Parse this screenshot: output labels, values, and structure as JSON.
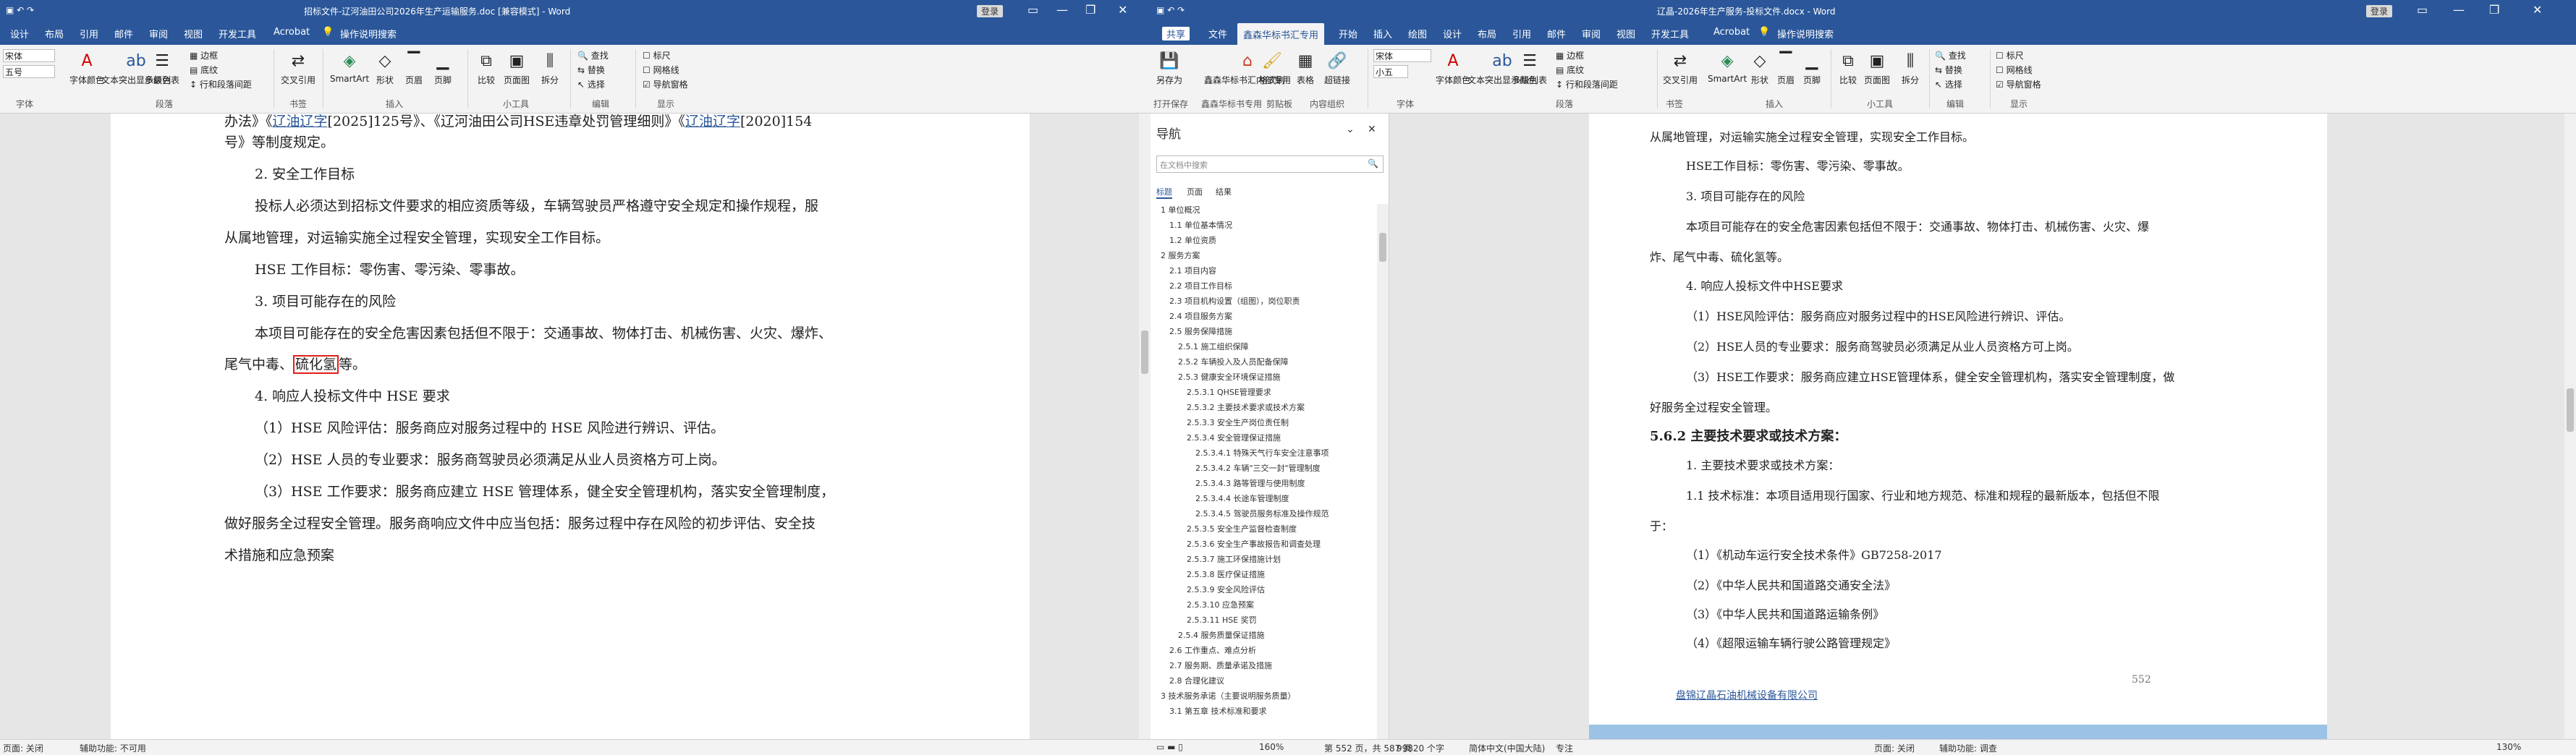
{
  "left_window": {
    "title": "招标文件-辽河油田公司2026年生产运输服务.doc [兼容模式] - Word",
    "signin": "登录",
    "qat": [
      "保存",
      "撤销",
      "重复"
    ],
    "tabs": [
      "设计",
      "布局",
      "引用",
      "邮件",
      "审阅",
      "视图",
      "开发工具",
      "Acrobat"
    ],
    "tell_me": "操作说明搜索",
    "ribbon": {
      "font_name": "宋体",
      "font_size": "五号",
      "font_buttons": [
        "字体颜色",
        "文本突出显示颜色",
        "多级列表"
      ],
      "para_small": [
        "边框",
        "底纹",
        "行和段落间距"
      ],
      "insert_buttons": [
        "交叉引用",
        "SmartArt",
        "形状",
        "页眉",
        "页脚"
      ],
      "tool_buttons": [
        "比较",
        "页面图",
        "拆分"
      ],
      "edit_small": [
        "查找",
        "替换",
        "选择"
      ],
      "show_small": [
        "标尺",
        "网格线",
        "导航窗格"
      ],
      "groups": [
        "字体",
        "段落",
        "书签",
        "插入",
        "小工具",
        "编辑",
        "显示"
      ]
    },
    "doc": {
      "line0_pre": "办法》《",
      "line0_link": "辽油辽字",
      "line0_mid": "[2025]125号》、《辽河油田公司HSE违章处罚管理细则》《",
      "line0_link2": "辽油辽字",
      "line0_post": "[2020]154",
      "line1": "号》等制度规定。",
      "h2": "2. 安全工作目标",
      "p2a": "投标人必须达到招标文件要求的相应资质等级，车辆驾驶员严格遵守安全规定和操作规程，服",
      "p2b": "从属地管理，对运输实施全过程安全管理，实现安全工作目标。",
      "hse": "HSE 工作目标：零伤害、零污染、零事故。",
      "h3": "3. 项目可能存在的风险",
      "p3a": "本项目可能存在的安全危害因素包括但不限于：交通事故、物体打击、机械伤害、火灾、爆炸、",
      "p3b_pre": "尾气中毒、",
      "p3b_hl": "硫化氢",
      "p3b_post": "等。",
      "h4": "4. 响应人投标文件中 HSE 要求",
      "i1": "（1）HSE 风险评估：服务商应对服务过程中的 HSE 风险进行辨识、评估。",
      "i2": "（2）HSE 人员的专业要求：服务商驾驶员必须满足从业人员资格方可上岗。",
      "i3a": "（3）HSE 工作要求：服务商应建立 HSE 管理体系，健全安全管理机构，落实安全管理制度，",
      "i3b": "做好服务全过程安全管理。服务商响应文件中应当包括：服务过程中存在风险的初步评估、安全技",
      "i3c": "术措施和应急预案"
    },
    "status": {
      "page": "页面: 关闭",
      "access": "辅助功能: 不可用"
    }
  },
  "right_window": {
    "title": "辽晶-2026年生产服务-投标文件.docx - Word",
    "signin": "登录",
    "share": "共享",
    "tabs": [
      "文件",
      "鑫森华标书汇专用",
      "开始",
      "插入",
      "绘图",
      "设计",
      "布局",
      "引用",
      "邮件",
      "审阅",
      "视图",
      "开发工具",
      "Acrobat"
    ],
    "tell_me": "操作说明搜索",
    "ribbon": {
      "big_buttons": [
        "另存为",
        "打开保存",
        "鑫森华标书汇内部专用",
        "格式刷",
        "表格",
        "超链接"
      ],
      "font_name": "宋体",
      "font_size": "小五",
      "font_buttons": [
        "字体颜色",
        "文本突出显示颜色",
        "多级列表"
      ],
      "para_small": [
        "边框",
        "底纹",
        "行和段落间距"
      ],
      "insert_buttons": [
        "交叉引用",
        "SmartArt",
        "形状",
        "页眉",
        "页脚"
      ],
      "tool_buttons": [
        "比较",
        "页面图",
        "拆分"
      ],
      "edit_small": [
        "查找",
        "替换",
        "选择"
      ],
      "show_small": [
        "标尺",
        "网格线",
        "导航窗格"
      ],
      "groups": [
        "打开保存",
        "鑫森华标书专用",
        "剪贴板",
        "内容组织",
        "字体",
        "段落",
        "书签",
        "插入",
        "小工具",
        "编辑",
        "显示"
      ]
    },
    "nav": {
      "title": "导航",
      "search_placeholder": "在文档中搜索",
      "tabs": [
        "标题",
        "页面",
        "结果"
      ],
      "items": [
        "1 单位概况",
        "1.1 单位基本情况",
        "1.2 单位资质",
        "2 服务方案",
        "2.1 项目内容",
        "2.2 项目工作目标",
        "2.3 项目机构设置（组图），岗位职责",
        "2.4 项目服务方案",
        "2.5 服务保障措施",
        "2.5.1 施工组织保障",
        "2.5.2 车辆投入及人员配备保障",
        "2.5.3 健康安全环境保证措施",
        "2.5.3.1 QHSE管理要求",
        "2.5.3.2 主要技术要求或技术方案",
        "2.5.3.3 安全生产岗位责任制",
        "2.5.3.4 安全管理保证措施",
        "2.5.3.4.1 特殊天气行车安全注意事项",
        "2.5.3.4.2 车辆\"三交一封\"管理制度",
        "2.5.3.4.3 路等管理与使用制度",
        "2.5.3.4.4 长途车管理制度",
        "2.5.3.4.5 驾驶员服务标准及操作规范",
        "2.5.3.5 安全生产监督检查制度",
        "2.5.3.6 安全生产事故报告和调查处理",
        "2.5.3.7 施工环保措施计划",
        "2.5.3.8 医疗保证措施",
        "2.5.3.9 安全风险评估",
        "2.5.3.10 应急预案",
        "2.5.3.11 HSE 奖罚",
        "2.5.4 服务质量保证措施",
        "2.6 工作重点、难点分析",
        "2.7 服务期、质量承诺及措施",
        "2.8 合理化建议",
        "3 技术服务承诺（主要说明服务质量）",
        "3.1 第五章 技术标准和要求"
      ]
    },
    "doc": {
      "l0": "从属地管理，对运输实施全过程安全管理，实现安全工作目标。",
      "l1": "HSE工作目标：零伤害、零污染、零事故。",
      "l2": "3. 项目可能存在的风险",
      "l3": "本项目可能存在的安全危害因素包括但不限于：交通事故、物体打击、机械伤害、火灾、爆",
      "l4": "炸、尾气中毒、硫化氢等。",
      "l5": "4. 响应人投标文件中HSE要求",
      "l6": "（1）HSE风险评估：服务商应对服务过程中的HSE风险进行辨识、评估。",
      "l7": "（2）HSE人员的专业要求：服务商驾驶员必须满足从业人员资格方可上岗。",
      "l8": "（3）HSE工作要求：服务商应建立HSE管理体系，健全安全管理机构，落实安全管理制度，做",
      "l9": "好服务全过程安全管理。",
      "l10": "5.6.2 主要技术要求或技术方案：",
      "l11": "1. 主要技术要求或技术方案：",
      "l12": "1.1 技术标准：本项目适用现行国家、行业和地方规范、标准和规程的最新版本，包括但不限",
      "l13": "于：",
      "l14": "（1）《机动车运行安全技术条件》GB7258-2017",
      "l15": "（2）《中华人民共和国道路交通安全法》",
      "l16": "（3）《中华人民共和国道路运输条例》",
      "l17": "（4）《超限运输车辆行驶公路管理规定》",
      "page_no": "552",
      "footer_company": "盘锦辽晶石油机械设备有限公司"
    },
    "status": {
      "page_info": "第 552 页，共 587 页",
      "words": "99820 个字",
      "lang": "简体中文(中国大陆)",
      "focus": "专注",
      "zoom_left": "160%",
      "page_mode": "页面: 关闭",
      "access": "辅助功能: 调查",
      "zoom_right": "130%"
    }
  },
  "far_right": {
    "share": "共享",
    "file": "文件",
    "edit": "编辑"
  }
}
